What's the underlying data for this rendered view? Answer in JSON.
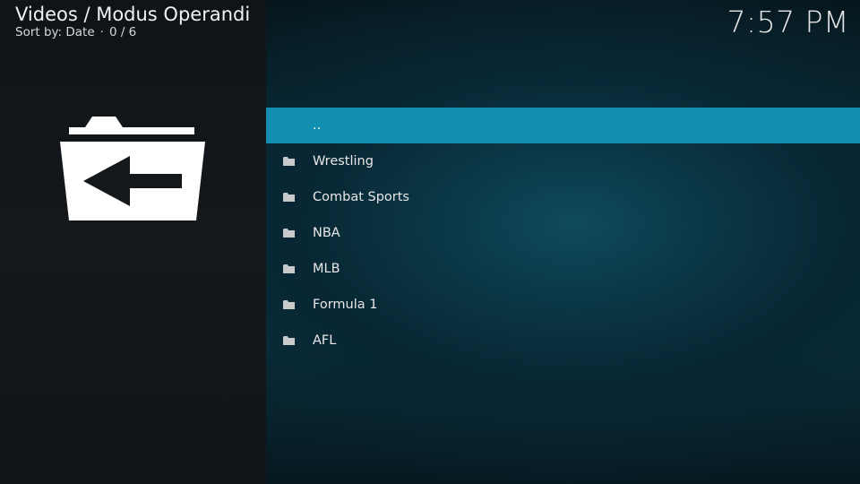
{
  "header": {
    "title": "Videos / Modus Operandi",
    "sort_label": "Sort by: Date",
    "separator": "·",
    "item_count": "0 / 6"
  },
  "clock": "7:57 PM",
  "preview": {
    "icon": "folder-back-icon"
  },
  "list": {
    "items": [
      {
        "label": "..",
        "icon": "",
        "selected": true
      },
      {
        "label": "Wrestling",
        "icon": "folder-icon",
        "selected": false
      },
      {
        "label": "Combat Sports",
        "icon": "folder-icon",
        "selected": false
      },
      {
        "label": "NBA",
        "icon": "folder-icon",
        "selected": false
      },
      {
        "label": "MLB",
        "icon": "folder-icon",
        "selected": false
      },
      {
        "label": "Formula 1",
        "icon": "folder-icon",
        "selected": false
      },
      {
        "label": "AFL",
        "icon": "folder-icon",
        "selected": false
      }
    ]
  },
  "colors": {
    "selection": "#128fb0",
    "left_panel": "#14181b",
    "background": "#0a3442"
  }
}
